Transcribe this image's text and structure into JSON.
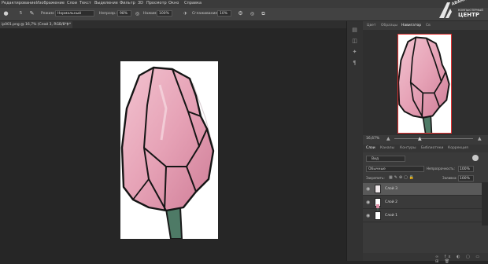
{
  "menu": [
    "Редактирование",
    "Изображение",
    "Слои",
    "Текст",
    "Выделение",
    "Фильтр",
    "3D",
    "Просмотр",
    "Окно",
    "Справка"
  ],
  "options": {
    "mode_label": "Режим:",
    "mode_value": "Нормальный",
    "opacity_label": "Непрозр.:",
    "opacity_value": "98%",
    "press_label": "Нажим:",
    "press_value": "100%",
    "smooth_label": "Сглаживание:",
    "smooth_value": "10%"
  },
  "document": {
    "tab_title": "ip001.png @ 16,7% (Слой 3, RGB/8*) *"
  },
  "panels": {
    "top_tabs": [
      "Цвет",
      "Образцы",
      "Навигатор",
      "Св"
    ],
    "navigator_zoom": "16,67%",
    "layer_tabs": [
      "Слои",
      "Каналы",
      "Контуры",
      "Библиотеки",
      "Коррекция"
    ],
    "kind_filter": "Вид",
    "blend_mode": "Обычные",
    "opacity_label": "Непрозрачность:",
    "opacity_value": "100%",
    "lock_label": "Закрепить:",
    "fill_label": "Заливка:",
    "fill_value": "100%",
    "layers": [
      {
        "name": "Слой 3",
        "selected": true
      },
      {
        "name": "Слой 2",
        "selected": false
      },
      {
        "name": "Слой 1",
        "selected": false
      }
    ]
  },
  "watermark": {
    "line1": "АВАНГАРД",
    "line2": "КОМПЬЮТЕРНЫЙ",
    "line3": "ЦЕНТР"
  },
  "colors": {
    "canvas": "#262626",
    "panel": "#3a3a3a",
    "selected_layer": "#595959",
    "navigator_frame": "#e03030",
    "petal_pink": "#e6a9bb",
    "stem_green": "#4e7a66"
  },
  "icons": {
    "close": "close-icon",
    "visibility": "eye-icon",
    "airbrush": "airbrush-icon",
    "settings": "gear-icon"
  }
}
